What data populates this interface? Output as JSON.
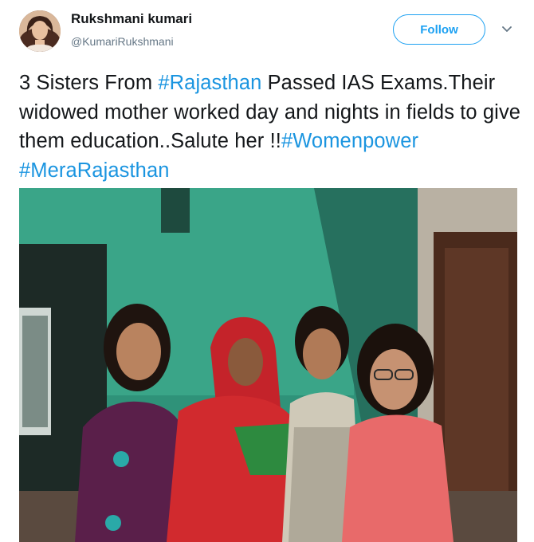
{
  "user": {
    "name": "Rukshmani kumari",
    "handle": "@KumariRukshmani"
  },
  "actions": {
    "follow_label": "Follow",
    "more_icon": "chevron-down-icon"
  },
  "tweet": {
    "text_part1": "3 Sisters From ",
    "hashtag1": "#Rajasthan",
    "text_part2": " Passed IAS Exams.Their widowed mother worked day and nights in fields to give them education..Salute her !!",
    "hashtag2": "#Womenpower",
    "hashtag3": "#MeraRajasthan"
  },
  "colors": {
    "link": "#1b95e0",
    "follow_border": "#1da1f2",
    "handle": "#657786"
  }
}
